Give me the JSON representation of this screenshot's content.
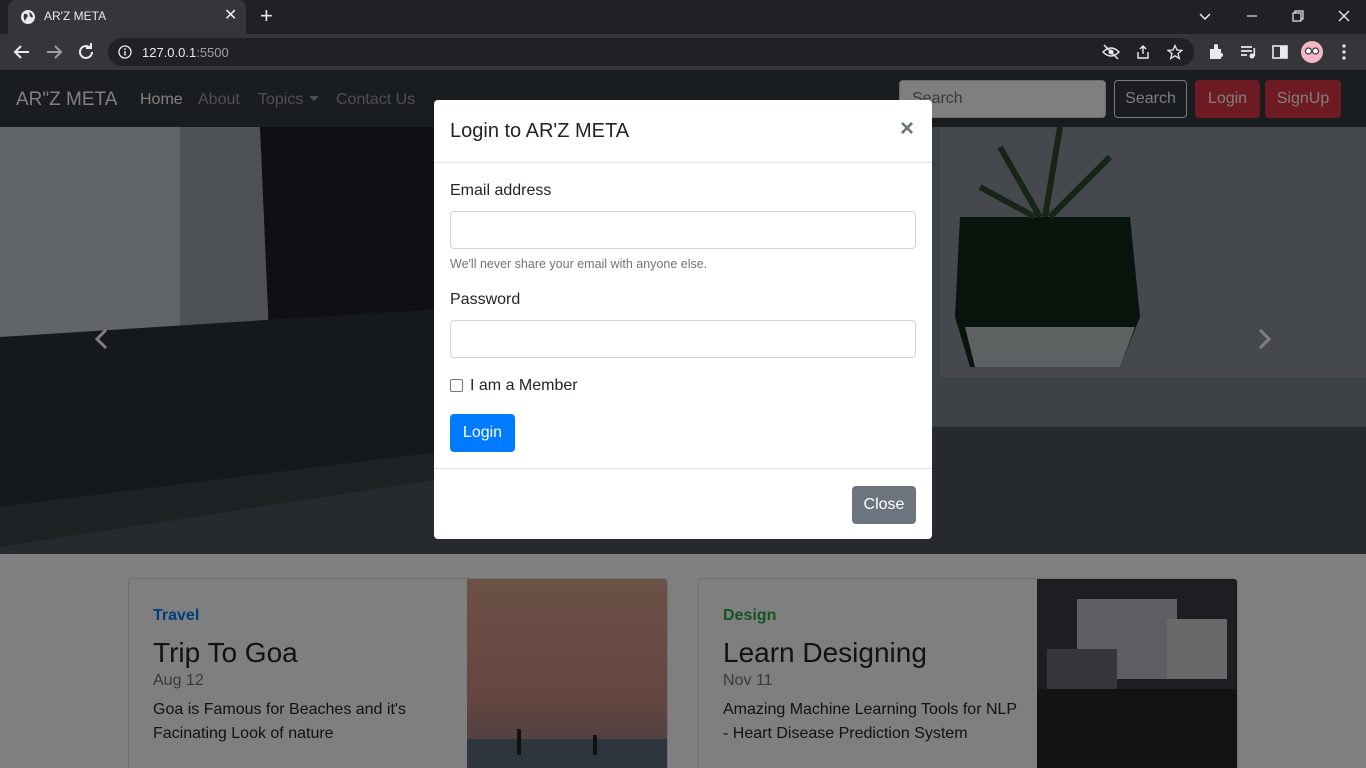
{
  "browser": {
    "tab_title": "AR'Z META",
    "url_host": "127.0.0.1",
    "url_port": ":5500"
  },
  "navbar": {
    "brand": "AR\"Z META",
    "links": [
      "Home",
      "About",
      "Topics",
      "Contact Us"
    ],
    "search_placeholder": "Search",
    "search_button": "Search",
    "login_button": "Login",
    "signup_button": "SignUp"
  },
  "cards": [
    {
      "category": "Travel",
      "category_color": "#007bff",
      "title": "Trip To Goa",
      "date": "Aug 12",
      "text": "Goa is Famous for Beaches and it's Facinating Look of nature"
    },
    {
      "category": "Design",
      "category_color": "#28a745",
      "title": "Learn Designing",
      "date": "Nov 11",
      "text": "Amazing Machine Learning Tools for NLP - Heart Disease Prediction System"
    }
  ],
  "modal": {
    "title": "Login to AR'Z META",
    "email_label": "Email address",
    "email_help": "We'll never share your email with anyone else.",
    "password_label": "Password",
    "checkbox_label": "I am a Member",
    "login_button": "Login",
    "close_button": "Close"
  },
  "colors": {
    "navbar_bg": "#343a40",
    "primary": "#007bff",
    "danger": "#dc3545",
    "secondary": "#6c757d"
  }
}
